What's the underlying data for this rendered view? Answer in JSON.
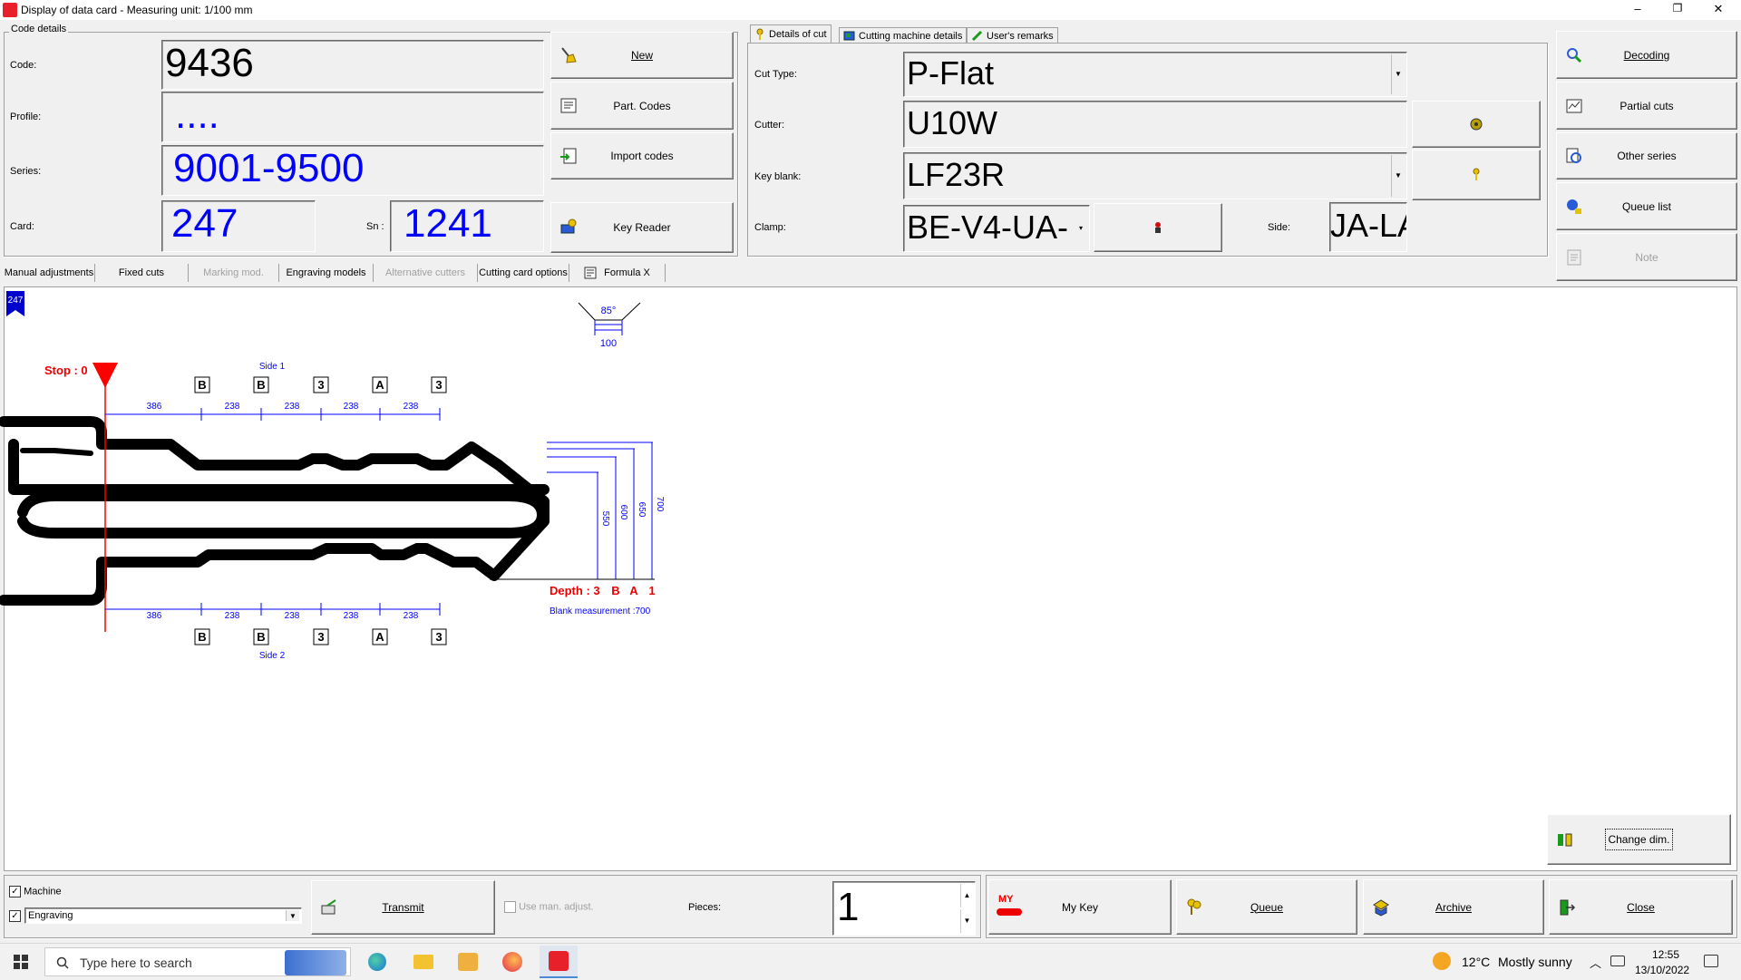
{
  "window": {
    "title": "Display of data card - Measuring unit: 1/100 mm",
    "controls": [
      "–",
      "❐",
      "✕"
    ]
  },
  "code_details": {
    "group_label": "Code details",
    "code_label": "Code:",
    "code_value": "9436",
    "profile_label": "Profile:",
    "profile_value": "....",
    "series_label": "Series:",
    "series_value": "9001-9500",
    "card_label": "Card:",
    "card_value": "247",
    "sn_label": "Sn :",
    "sn_value": "1241"
  },
  "left_buttons": {
    "new": "New",
    "part_codes": "Part. Codes",
    "import_codes": "Import codes",
    "key_reader": "Key Reader"
  },
  "top_tabs": [
    "Details of cut",
    "Cutting machine details",
    "User's remarks"
  ],
  "cut_details": {
    "cut_type_label": "Cut Type:",
    "cut_type_value": "P-Flat",
    "cutter_label": "Cutter:",
    "cutter_value": "U10W",
    "key_blank_label": "Key blank:",
    "key_blank_value": "LF23R",
    "clamp_label": "Clamp:",
    "clamp_value": "BE-V4-UA-",
    "side_label": "Side:",
    "side_value": "JA-LA"
  },
  "right_buttons": {
    "decoding": "Decoding",
    "partial_cuts": "Partial cuts",
    "other_series": "Other series",
    "queue_list": "Queue list",
    "note": "Note"
  },
  "mode_tabs": [
    {
      "label": "Manual adjustments",
      "enabled": true
    },
    {
      "label": "Fixed cuts",
      "enabled": true
    },
    {
      "label": "Marking mod.",
      "enabled": false
    },
    {
      "label": "Engraving models",
      "enabled": true
    },
    {
      "label": "Alternative cutters",
      "enabled": false
    },
    {
      "label": "Cutting card options",
      "enabled": true
    },
    {
      "label": "Formula X",
      "enabled": true
    }
  ],
  "drawing": {
    "card_badge": "247",
    "angle_label": "85°",
    "width_label": "100",
    "stop_label": "Stop : 0",
    "side1_label": "Side 1",
    "side2_label": "Side 2",
    "side1_cuts": [
      "B",
      "B",
      "3",
      "A",
      "3"
    ],
    "side2_cuts": [
      "B",
      "B",
      "3",
      "A",
      "3"
    ],
    "spacings": [
      "386",
      "238",
      "238",
      "238",
      "238"
    ],
    "depth_values": [
      "550",
      "600",
      "650",
      "700"
    ],
    "depth_label": "Depth : 3",
    "depth_codes": [
      "B",
      "A",
      "1"
    ],
    "blank_measurement": "Blank measurement :700"
  },
  "change_dim": "Change dim.",
  "bottom": {
    "machine_label": "Machine",
    "engraving_value": "Engraving",
    "transmit": "Transmit",
    "use_man_adjust": "Use man. adjust.",
    "pieces_label": "Pieces:",
    "pieces_value": "1",
    "my_key": "My Key",
    "my_badge": "MY",
    "queue": "Queue",
    "archive": "Archive",
    "close": "Close"
  },
  "taskbar": {
    "search_placeholder": "Type here to search",
    "temperature": "12°C",
    "weather": "Mostly sunny",
    "time": "12:55",
    "date": "13/10/2022"
  },
  "colors": {
    "accent_blue": "#0000ff",
    "accent_red": "#ff0000",
    "window_bg": "#f0f0f0"
  }
}
